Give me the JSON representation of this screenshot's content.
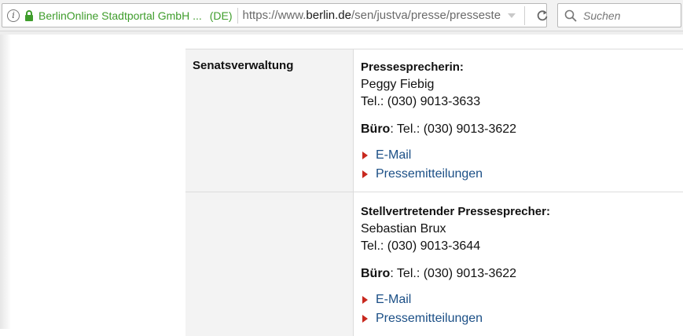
{
  "browser": {
    "site_identity": "BerlinOnline Stadtportal GmbH ...",
    "country": "(DE)",
    "url_prefix": "https://www.",
    "url_host": "berlin.de",
    "url_path": "/sen/justva/presse/pressestе",
    "search_placeholder": "Suchen"
  },
  "table": {
    "department": "Senatsverwaltung",
    "contacts": [
      {
        "role": "Pressesprecherin:",
        "name": "Peggy Fiebig",
        "phone": "Tel.: (030) 9013-3633",
        "office_label": "Büro",
        "office_phone": ": Tel.: (030) 9013-3622",
        "links": [
          "E-Mail",
          "Pressemitteilungen"
        ]
      },
      {
        "role": "Stellvertretender Pressesprecher:",
        "name": "Sebastian Brux",
        "phone": "Tel.: (030) 9013-3644",
        "office_label": "Büro",
        "office_phone": ": Tel.: (030) 9013-3622",
        "links": [
          "E-Mail",
          "Pressemitteilungen"
        ]
      }
    ]
  },
  "colors": {
    "identity_green": "#3f9d2c",
    "link_blue": "#1b4f86",
    "arrow_red": "#c8281e"
  }
}
